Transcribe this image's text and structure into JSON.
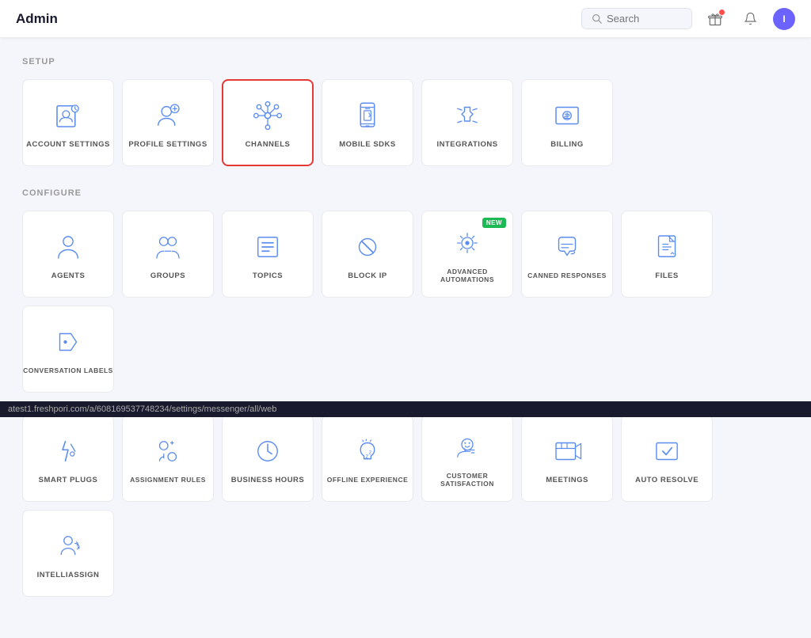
{
  "topbar": {
    "title": "Admin",
    "search_placeholder": "Search",
    "avatar_initial": "I"
  },
  "setup": {
    "section_label": "SETUP",
    "cards": [
      {
        "id": "account-settings",
        "label": "ACCOUNT SETTINGS",
        "highlighted": false,
        "icon": "account"
      },
      {
        "id": "profile-settings",
        "label": "PROFILE SETTINGS",
        "highlighted": false,
        "icon": "profile"
      },
      {
        "id": "channels",
        "label": "CHANNELS",
        "highlighted": true,
        "icon": "channels"
      },
      {
        "id": "mobile-sdks",
        "label": "MOBILE SDKS",
        "highlighted": false,
        "icon": "mobile"
      },
      {
        "id": "integrations",
        "label": "INTEGRATIONS",
        "highlighted": false,
        "icon": "integrations"
      },
      {
        "id": "billing",
        "label": "BILLING",
        "highlighted": false,
        "icon": "billing"
      }
    ]
  },
  "configure": {
    "section_label": "CONFIGURE",
    "cards": [
      {
        "id": "agents",
        "label": "AGENTS",
        "highlighted": false,
        "icon": "agents",
        "new": false
      },
      {
        "id": "groups",
        "label": "GROUPS",
        "highlighted": false,
        "icon": "groups",
        "new": false
      },
      {
        "id": "topics",
        "label": "TOPICS",
        "highlighted": false,
        "icon": "topics",
        "new": false
      },
      {
        "id": "block-ip",
        "label": "BLOCK IP",
        "highlighted": false,
        "icon": "blockip",
        "new": false
      },
      {
        "id": "advanced-automations",
        "label": "ADVANCED AUTOMATIONS",
        "highlighted": false,
        "icon": "automations",
        "new": true
      },
      {
        "id": "canned-responses",
        "label": "CANNED RESPONSES",
        "highlighted": false,
        "icon": "canned",
        "new": false
      },
      {
        "id": "files",
        "label": "FILES",
        "highlighted": false,
        "icon": "files",
        "new": false
      },
      {
        "id": "conversation-labels",
        "label": "CONVERSATION LABELS",
        "highlighted": false,
        "icon": "labels",
        "new": false
      }
    ]
  },
  "configure2": {
    "cards": [
      {
        "id": "smart-plugs",
        "label": "SMART PLUGS",
        "highlighted": false,
        "icon": "smartplugs",
        "new": false
      },
      {
        "id": "assignment-rules",
        "label": "ASSIGNMENT RULES",
        "highlighted": false,
        "icon": "assignment",
        "new": false
      },
      {
        "id": "business-hours",
        "label": "BUSINESS HOURS",
        "highlighted": false,
        "icon": "businesshours",
        "new": false
      },
      {
        "id": "offline-experience",
        "label": "OFFLINE EXPERIENCE",
        "highlighted": false,
        "icon": "offline",
        "new": false
      },
      {
        "id": "customer-satisfaction",
        "label": "CUSTOMER SATISFACTION",
        "highlighted": false,
        "icon": "satisfaction",
        "new": false
      },
      {
        "id": "meetings",
        "label": "MEETINGS",
        "highlighted": false,
        "icon": "meetings",
        "new": false
      },
      {
        "id": "auto-resolve",
        "label": "AUTO RESOLVE",
        "highlighted": false,
        "icon": "autoresolve",
        "new": false
      },
      {
        "id": "intelliassign",
        "label": "INTELLIASSIGN",
        "highlighted": false,
        "icon": "intelliassign",
        "new": false
      }
    ]
  },
  "bottom_bar": {
    "text": "atest1.freshpori.com/a/608169537748234/settings/messenger/all/web"
  }
}
